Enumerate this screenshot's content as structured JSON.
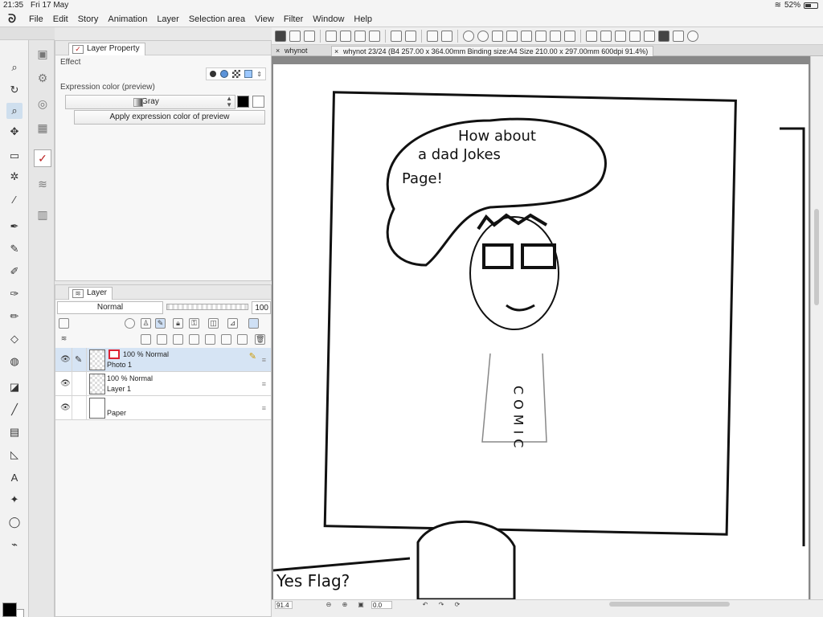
{
  "status": {
    "time": "21:35",
    "date": "Fri 17 May",
    "battery": "52%",
    "battery_level": 0.52
  },
  "menu": {
    "items": [
      "File",
      "Edit",
      "Story",
      "Animation",
      "Layer",
      "Selection area",
      "View",
      "Filter",
      "Window",
      "Help"
    ]
  },
  "layer_property": {
    "tab": "Layer Property",
    "effect_label": "Effect",
    "expression_label": "Expression color (preview)",
    "expression_value": "Gray",
    "apply_button": "Apply expression color of preview"
  },
  "layer_panel": {
    "tab": "Layer",
    "blend_mode": "Normal",
    "opacity": "100",
    "layers": [
      {
        "mode": "100 % Normal",
        "name": "Photo 1"
      },
      {
        "mode": "100 % Normal",
        "name": "Layer 1"
      },
      {
        "name": "Paper"
      }
    ]
  },
  "doc_tabs": [
    {
      "label": "whynot"
    },
    {
      "label": "whynot 23/24 (B4 257.00 x 364.00mm Binding size:A4 Size 210.00 x 297.00mm 600dpi 91.4%)"
    }
  ],
  "canvas": {
    "bubble_text": "How about a dad Jokes Page!",
    "shirt_text": "COMIC",
    "bottom_text": "Yes Flag?"
  },
  "bottom": {
    "zoom": "91.4",
    "rotation": "0.0"
  },
  "colors": {
    "foreground": "#000000",
    "background": "#ffffff",
    "accent": "#d6e4f4"
  }
}
